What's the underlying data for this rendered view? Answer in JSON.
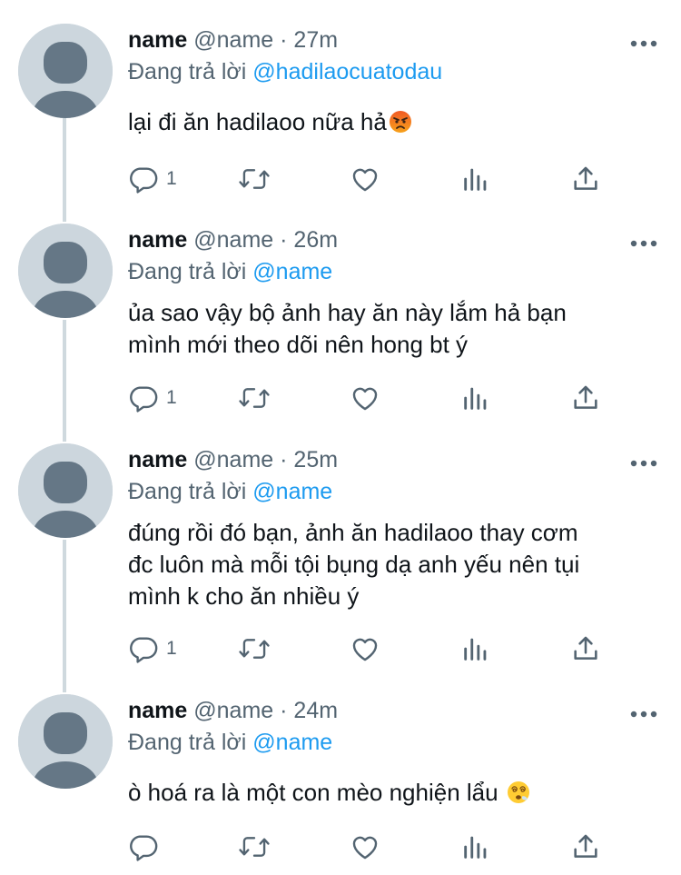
{
  "tweets": [
    {
      "name": "name",
      "handle": "@name",
      "time": "27m",
      "replying_prefix": "Đang trả lời",
      "replying_to": "@hadilaocuatodau",
      "text": "lại đi ăn hadilaoo nữa hả",
      "emoji": "angry-face-emoji",
      "reply_count": "1"
    },
    {
      "name": "name",
      "handle": "@name",
      "time": "26m",
      "replying_prefix": "Đang trả lời",
      "replying_to": "@name",
      "text": "ủa sao vậy bộ ảnh hay ăn này lắm hả bạn\nmình mới theo dõi nên hong bt ý",
      "reply_count": "1"
    },
    {
      "name": "name",
      "handle": "@name",
      "time": "25m",
      "replying_prefix": "Đang trả lời",
      "replying_to": "@name",
      "text": "đúng rồi đó bạn, ảnh ăn hadilaoo thay cơm\nđc luôn mà mỗi tội bụng dạ anh yếu nên tụi\nmình k cho ăn nhiều ý",
      "reply_count": "1"
    },
    {
      "name": "name",
      "handle": "@name",
      "time": "24m",
      "replying_prefix": "Đang trả lời",
      "replying_to": "@name",
      "text": "ò hoá ra là một con mèo nghiện lẩu",
      "emoji": "face-with-spiral-eyes-emoji",
      "reply_count": ""
    }
  ],
  "separator": "·",
  "icons": {
    "reply": "reply-icon",
    "retweet": "retweet-icon",
    "like": "heart-icon",
    "views": "views-icon",
    "share": "share-icon",
    "more": "more-icon"
  },
  "colors": {
    "text": "#0f1419",
    "secondary": "#536471",
    "accent": "#1d9bf0",
    "avatar_bg": "#ccd6dd",
    "avatar_fg": "#657786",
    "thread_line": "#cfd9de"
  }
}
